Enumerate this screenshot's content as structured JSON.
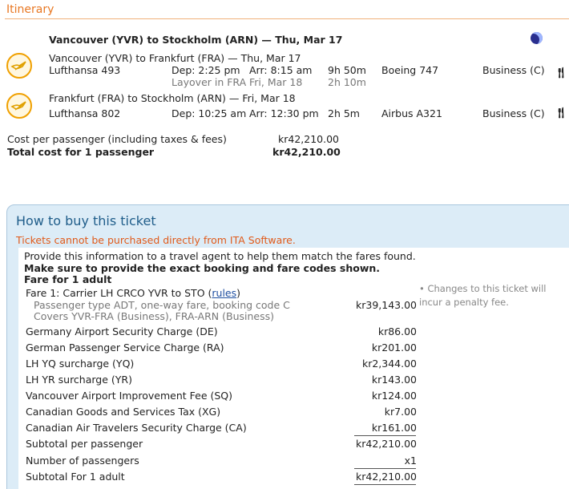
{
  "section": {
    "title": "Itinerary"
  },
  "route_title": "Vancouver (YVR) to Stockholm (ARN) — Thu, Mar 17",
  "segments": [
    {
      "route": "Vancouver (YVR) to Frankfurt (FRA) — Thu, Mar 17",
      "flight": "Lufthansa 493",
      "dep": "Dep: 2:25 pm",
      "arr": "Arr: 8:15 am",
      "duration": "9h 50m",
      "aircraft": "Boeing 747",
      "cabin": "Business (C)",
      "layover_label": "Layover in FRA",
      "layover_date": "Fri, Mar 18",
      "layover_duration": "2h 10m"
    },
    {
      "route": "Frankfurt (FRA) to Stockholm (ARN) — Fri, Mar 18",
      "flight": "Lufthansa 802",
      "dep": "Dep: 10:25 am",
      "arr": "Arr: 12:30 pm",
      "duration": "2h 5m",
      "aircraft": "Airbus A321",
      "cabin": "Business (C)"
    }
  ],
  "meal_icon": "fork-knife-icon",
  "night_icon": "moon-icon",
  "costs": {
    "per_passenger_label": "Cost per passenger (including taxes & fees)",
    "per_passenger_value": "kr42,210.00",
    "total_label": "Total cost for 1 passenger",
    "total_value": "kr42,210.00"
  },
  "buy": {
    "title": "How to buy this ticket",
    "warning": "Tickets cannot be purchased directly from ITA Software.",
    "intro": "Provide this information to a travel agent to help them match the fares found.",
    "instruction": "Make sure to provide the exact booking and fare codes shown.",
    "fare_for": "Fare for 1 adult",
    "fare_line_prefix": "Fare 1: Carrier LH CRCO YVR to STO (",
    "fare_rules_link": "rules",
    "fare_line_suffix": ")",
    "fare_detail_1": "Passenger type ADT, one-way fare, booking code C",
    "fare_detail_2": "Covers YVR-FRA (Business), FRA-ARN (Business)",
    "fare_amount": "kr39,143.00",
    "charges": [
      {
        "label": "Germany Airport Security Charge (DE)",
        "amount": "kr86.00"
      },
      {
        "label": "German Passenger Service Charge (RA)",
        "amount": "kr201.00"
      },
      {
        "label": "LH YQ surcharge (YQ)",
        "amount": "kr2,344.00"
      },
      {
        "label": "LH YR surcharge (YR)",
        "amount": "kr143.00"
      },
      {
        "label": "Vancouver Airport Improvement Fee (SQ)",
        "amount": "kr124.00"
      },
      {
        "label": "Canadian Goods and Services Tax (XG)",
        "amount": "kr7.00"
      },
      {
        "label": "Canadian Air Travelers Security Charge (CA)",
        "amount": "kr161.00"
      }
    ],
    "subtotal_label": "Subtotal per passenger",
    "subtotal_amount": "kr42,210.00",
    "passengers_label": "Number of passengers",
    "passengers_value": "x1",
    "subtotal1_label": "Subtotal For 1 adult",
    "subtotal1_amount": "kr42,210.00",
    "note_bullet": "•",
    "note_text": "Changes to this ticket will incur a penalty fee."
  }
}
